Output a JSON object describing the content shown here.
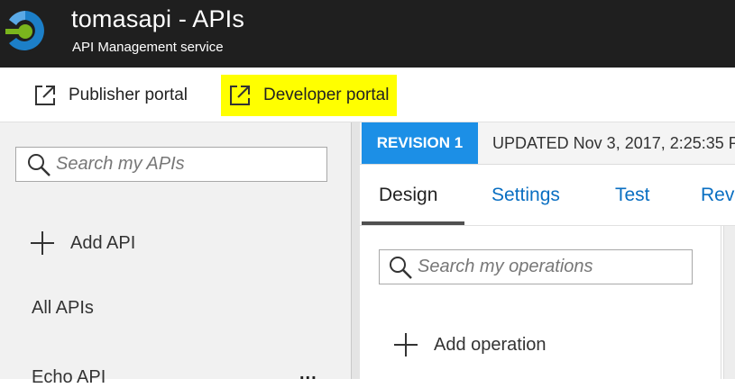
{
  "header": {
    "title": "tomasapi - APIs",
    "subtitle": "API Management service",
    "logo_icon": "api-management-logo-icon",
    "colors": {
      "background": "#1f1f1f",
      "logo_blue": "#1c7fc8",
      "logo_green": "#7ab51d"
    }
  },
  "toolbar": {
    "publisher_portal_label": "Publisher portal",
    "developer_portal_label": "Developer portal",
    "external_link_icon": "external-link-icon",
    "highlight_color": "#ffff00"
  },
  "sidebar": {
    "search_placeholder": "Search my APIs",
    "add_api_label": "Add API",
    "all_apis_label": "All APIs",
    "items": [
      {
        "label": "Echo API",
        "more": "..."
      }
    ]
  },
  "revision": {
    "badge": "REVISION 1",
    "updated_text": "UPDATED Nov 3, 2017, 2:25:35 P",
    "badge_color": "#1c8fe6"
  },
  "tabs": [
    {
      "label": "Design",
      "active": true
    },
    {
      "label": "Settings",
      "active": false
    },
    {
      "label": "Test",
      "active": false
    },
    {
      "label": "Revi",
      "active": false
    }
  ],
  "operations": {
    "search_placeholder": "Search my operations",
    "add_operation_label": "Add operation"
  }
}
